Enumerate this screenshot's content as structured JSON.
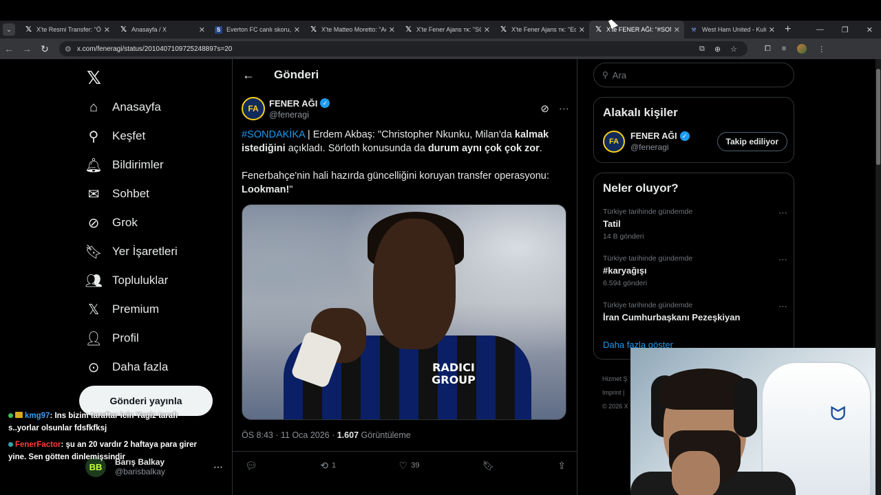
{
  "browser": {
    "tabs": [
      {
        "favicon": "x-icon",
        "title": "X'te Resmi Transfer: \"ÖZEL",
        "active": false
      },
      {
        "favicon": "x-icon",
        "title": "Anasayfa / X",
        "active": false
      },
      {
        "favicon": "everton-icon",
        "title": "Everton FC canlı skoru, tak",
        "active": false
      },
      {
        "favicon": "x-icon",
        "title": "X'te Matteo Moretto: \"Aci",
        "active": false
      },
      {
        "favicon": "x-icon",
        "title": "X'te Fener Ajans ᴛᴋ: \"SON",
        "active": false
      },
      {
        "favicon": "x-icon",
        "title": "X'te Fener Ajans ᴛᴋ: \"Eden",
        "active": false
      },
      {
        "favicon": "x-icon",
        "title": "X'te FENER AĞI: \"#SONDA",
        "active": true
      },
      {
        "favicon": "westham-icon",
        "title": "West Ham United - Kulüp",
        "active": false
      }
    ],
    "url": "x.com/feneragi/status/2010407109725248897s=20"
  },
  "nav": {
    "items": [
      {
        "icon": "home-icon",
        "label": "Anasayfa"
      },
      {
        "icon": "search-icon",
        "label": "Keşfet"
      },
      {
        "icon": "bell-icon",
        "label": "Bildirimler"
      },
      {
        "icon": "mail-icon",
        "label": "Sohbet"
      },
      {
        "icon": "grok-icon",
        "label": "Grok"
      },
      {
        "icon": "bookmark-icon",
        "label": "Yer İşaretleri"
      },
      {
        "icon": "communities-icon",
        "label": "Topluluklar"
      },
      {
        "icon": "x-premium-icon",
        "label": "Premium"
      },
      {
        "icon": "profile-icon",
        "label": "Profil"
      },
      {
        "icon": "more-circle-icon",
        "label": "Daha fazla"
      }
    ],
    "post_button": "Gönderi yayınla",
    "account": {
      "name": "Barış Balkay",
      "handle": "@barisbalkay",
      "initials": "BB"
    }
  },
  "chat_overlay": {
    "messages": [
      {
        "user": "kmg97",
        "text": ": Ins bizim taraftar icin Yagiz tarafı s..yorlar olsunlar fdsfkfksj"
      },
      {
        "user": "FenerFactor",
        "text": ": şu an 20 vardır 2 haftaya para girer yine. Sen götten dinlemişsindir"
      }
    ]
  },
  "main": {
    "header_title": "Gönderi",
    "tweet": {
      "author_name": "FENER AĞI",
      "author_handle": "@feneragi",
      "hashtag": "#SONDAKİKA",
      "text_1": " | Erdem Akbaş: \"Christopher Nkunku, Milan'da ",
      "bold_1": "kalmak istediğini",
      "text_2": " açıkladı. Sörloth konusunda da ",
      "bold_2": "durum aynı çok çok zor",
      "text_3": ".",
      "text_4": "Fenerbahçe'nin hali hazırda güncelliğini koruyan transfer operasyonu: ",
      "bold_3": "Lookman!",
      "text_5": "\"",
      "media_sponsor": "RADICI GROUP",
      "time": "ÖS 8:43 · 11 Oca 2026 · ",
      "views": "1.607",
      "views_label": " Görüntüleme",
      "retweets": "1",
      "likes": "39"
    }
  },
  "sidebar": {
    "search_placeholder": "Ara",
    "related_title": "Alakalı kişiler",
    "related_person": {
      "name": "FENER AĞI",
      "handle": "@feneragi",
      "button": "Takip ediliyor"
    },
    "trends_title": "Neler oluyor?",
    "trends": [
      {
        "context": "Türkiye tarihinde gündemde",
        "title": "Tatil",
        "count": "14 B gönderi"
      },
      {
        "context": "Türkiye tarihinde gündemde",
        "title": "#karyağışı",
        "count": "6.594 gönderi"
      },
      {
        "context": "Türkiye tarihinde gündemde",
        "title": "İran Cumhurbaşkanı Pezeşkiyan",
        "count": ""
      }
    ],
    "show_more": "Daha fazla göster",
    "footer": [
      "Hizmet Ş",
      "Imprint  |",
      "© 2026 X"
    ]
  },
  "colors": {
    "accent": "#1d9bf0",
    "background": "#000000",
    "border": "#2f3336"
  }
}
